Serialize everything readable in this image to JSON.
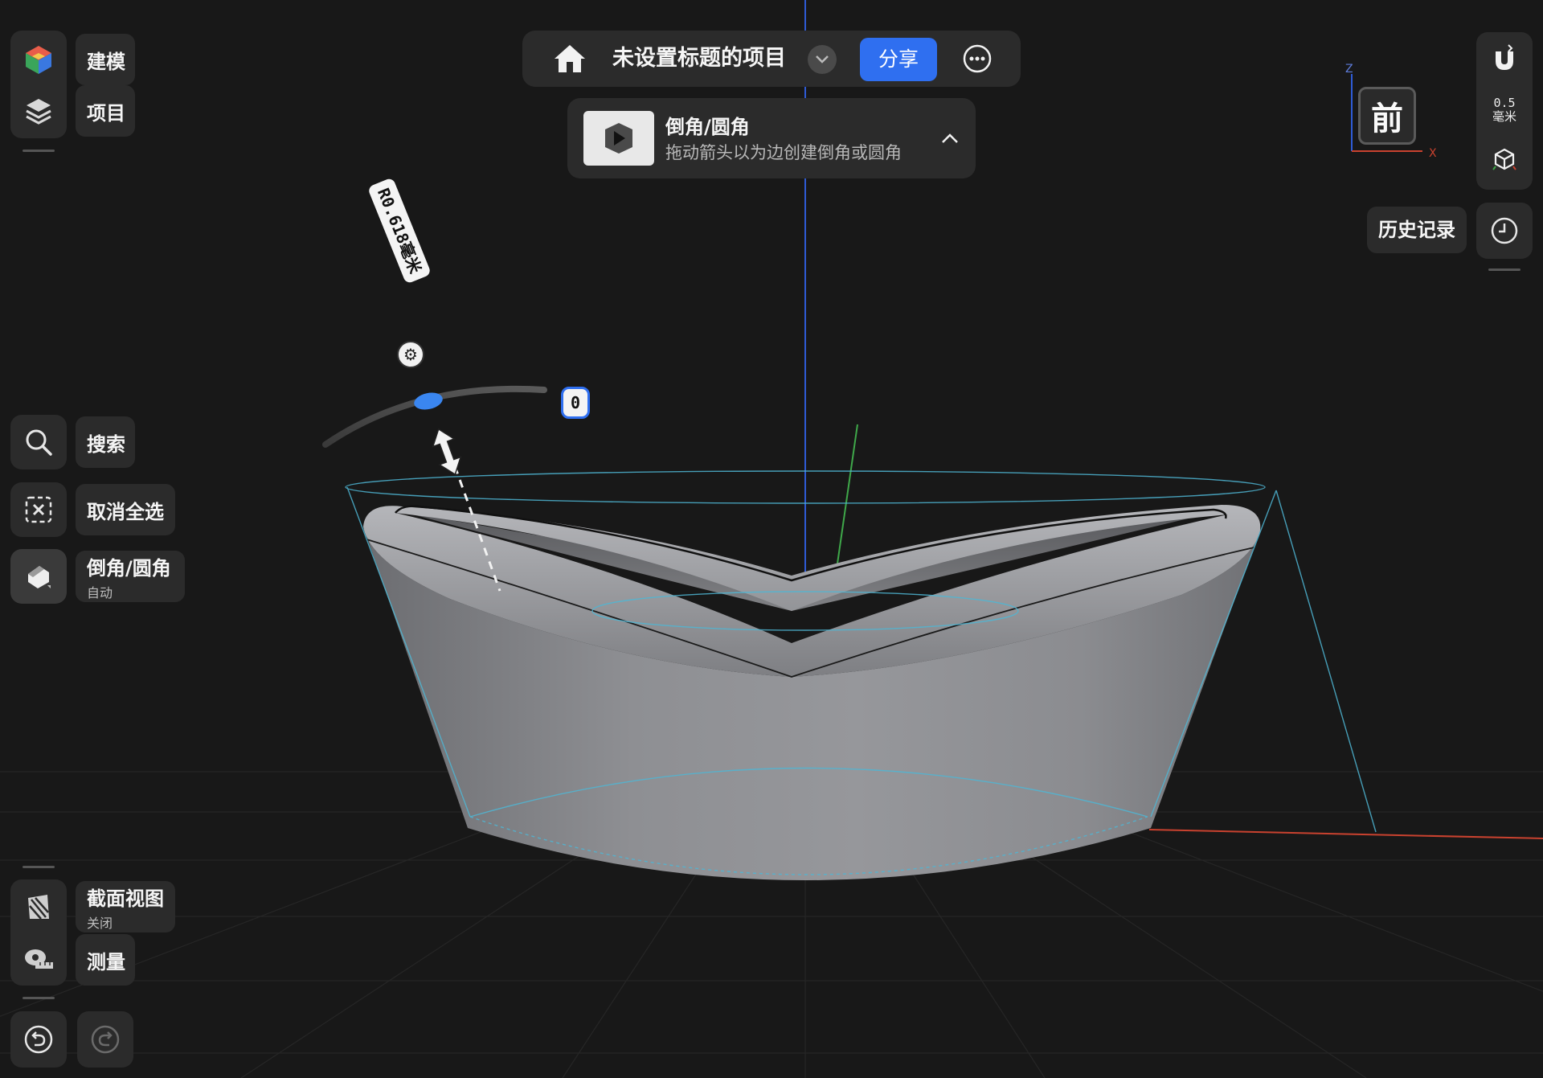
{
  "left_toolbar": {
    "modeling_label": "建模",
    "project_label": "项目",
    "search_label": "搜索",
    "deselect_label": "取消全选",
    "fillet_label": "倒角/圆角",
    "fillet_sub": "自动",
    "section_label": "截面视图",
    "section_sub": "关闭",
    "measure_label": "测量"
  },
  "topbar": {
    "project_title": "未设置标题的项目",
    "share_label": "分享"
  },
  "hint": {
    "title": "倒角/圆角",
    "description": "拖动箭头以为边创建倒角或圆角"
  },
  "viewport": {
    "radius_label": "R0.618毫米",
    "segments_value": "0",
    "view_cube_face": "前",
    "axis_z": "Z",
    "axis_x": "X"
  },
  "right_toolbar": {
    "snap_value": "0.5",
    "snap_unit": "毫米",
    "history_label": "历史记录"
  },
  "colors": {
    "background": "#181818",
    "panel": "#2b2b2b",
    "accent_blue": "#2f6ff0",
    "model_gray": "#8a8b8f",
    "axis_blue": "#2f5bd6",
    "axis_green": "#3fa84a",
    "axis_red": "#c9422f",
    "wire_cyan": "#4fb6d4"
  },
  "icons": {
    "modeling": "cube-color-icon",
    "project": "layers-icon",
    "search": "search-icon",
    "deselect": "deselect-icon",
    "fillet": "fillet-icon",
    "section": "section-view-icon",
    "measure": "tape-measure-icon",
    "undo": "undo-icon",
    "redo": "redo-icon",
    "home": "home-icon",
    "dropdown": "chevron-down-icon",
    "more": "more-icon",
    "collapse": "chevron-up-icon",
    "magnet": "magnet-icon",
    "view": "view-cube-icon",
    "history": "clock-icon"
  }
}
